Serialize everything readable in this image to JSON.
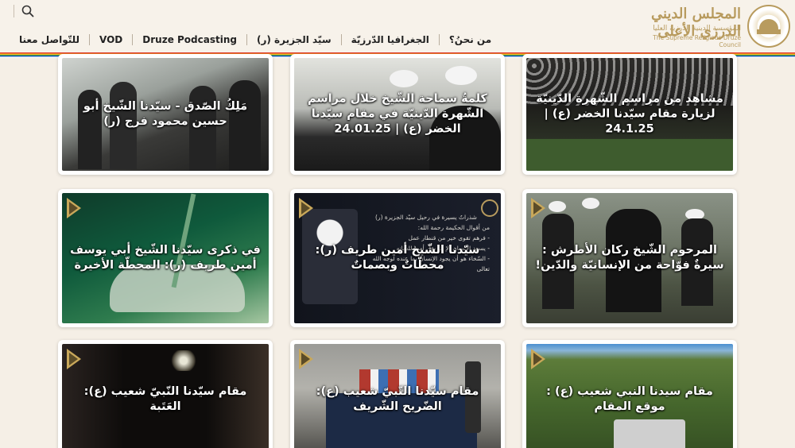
{
  "header": {
    "logo_title": "المجلس الديني الدرزي الأعلى",
    "logo_subtitle": "المؤسسة الدينية الدرزية العليا",
    "logo_english": "The Supreme Religious Druze Council",
    "nav": [
      {
        "label": "للتّواصل معنا"
      },
      {
        "label": "VOD"
      },
      {
        "label": "Druze Podcasting"
      },
      {
        "label": "سيّد الجزيرة (ر)"
      },
      {
        "label": "الجغرافيا الدّرزيّة"
      },
      {
        "label": "من نحنُ؟"
      }
    ]
  },
  "colors": {
    "accent_gold": "#c9a85a",
    "background": "#f5efe6"
  },
  "videos": [
    {
      "title": "مَلِكُ الصّدق - سيّدنا الشّيخ أبو حسين محمود فرج (ر)"
    },
    {
      "title": "كلمةُ سماحة الشّيخ خلال مراسم الشّهرة الدّينيّة في مقام سيّدنا الخضر (ع) | 24.01.25"
    },
    {
      "title": "مشاهد من مراسم الشّهرة الدّينيّة لزيارة مقام سيّدنا الخضر (ع) | 24.1.25"
    },
    {
      "title": "في ذكرى سيّدنا الشّيخ أبي يوسف أمين طريف (ر): المحطّة الأخيرة"
    },
    {
      "title": "سيّدنا الشّيخ أمين طريف (ر): محطّاتٌ وبصماتٌ"
    },
    {
      "title": "المرحوم الشّيخ ركان الأطرش : سيرةٌ فوّاحة من الإنسانيّة والدّين!"
    },
    {
      "title": "مقام سيّدنا النّبيّ شعيب (ع): العَتَبة"
    },
    {
      "title": "مقام سيّدنا النّبيّ شعيب (ع): الضّريح الشّريف"
    },
    {
      "title": "مقام سيدنا النبي شعيب (ع) : موقع المقام"
    }
  ],
  "poster_text": {
    "heading": "شذراتٌ يسيرة في رحيل سيّد الجزيرة (ر)",
    "line1": "من أقوال الحكيمة رحمة الله:",
    "line2": "- فرهم تقوى خير من قنطار عمل",
    "line3": "- يسعد الإنسان الإ إذا بقي أمينا للسانه",
    "line4": "- السّخاء هو أن يجود الإنسان بما عنده لوجه الله تعالى"
  }
}
